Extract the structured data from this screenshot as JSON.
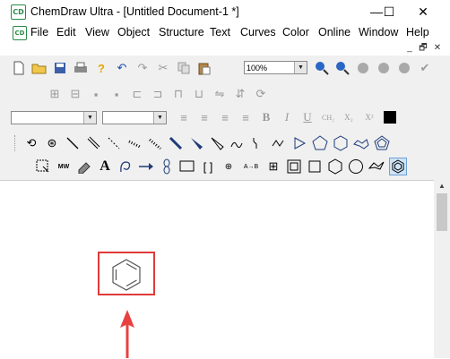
{
  "window": {
    "title": "ChemDraw Ultra - [Untitled Document-1 *]",
    "app_icon": "CD"
  },
  "window_controls": {
    "minimize": "—",
    "maximize": "☐",
    "close": "✕"
  },
  "menu": {
    "items": [
      "File",
      "Edit",
      "View",
      "Object",
      "Structure",
      "Text",
      "Curves",
      "Color",
      "Online",
      "Window",
      "Help"
    ]
  },
  "doc_controls": {
    "minimize": "_",
    "restore": "🗗",
    "close": "✕"
  },
  "toolbar": {
    "zoom_value": "100%",
    "style_text": {
      "bold": "B",
      "italic": "I",
      "underline": "U",
      "formula": "CH₂",
      "subscript": "X₂",
      "superscript": "X²"
    },
    "tool_texts": {
      "mw_label": "MW",
      "text_tool": "A",
      "bracket": "[ ]",
      "a_to_b": "A→B",
      "plus_circle": "⊕"
    }
  },
  "colors": {
    "highlight": "#e03a3a",
    "arrow": "#e84040",
    "toolbar_bg": "#f0f0f0",
    "accent_green": "#2a8a4a"
  },
  "annotation": {
    "type": "red box with up arrow",
    "target": "benzene-ring"
  }
}
